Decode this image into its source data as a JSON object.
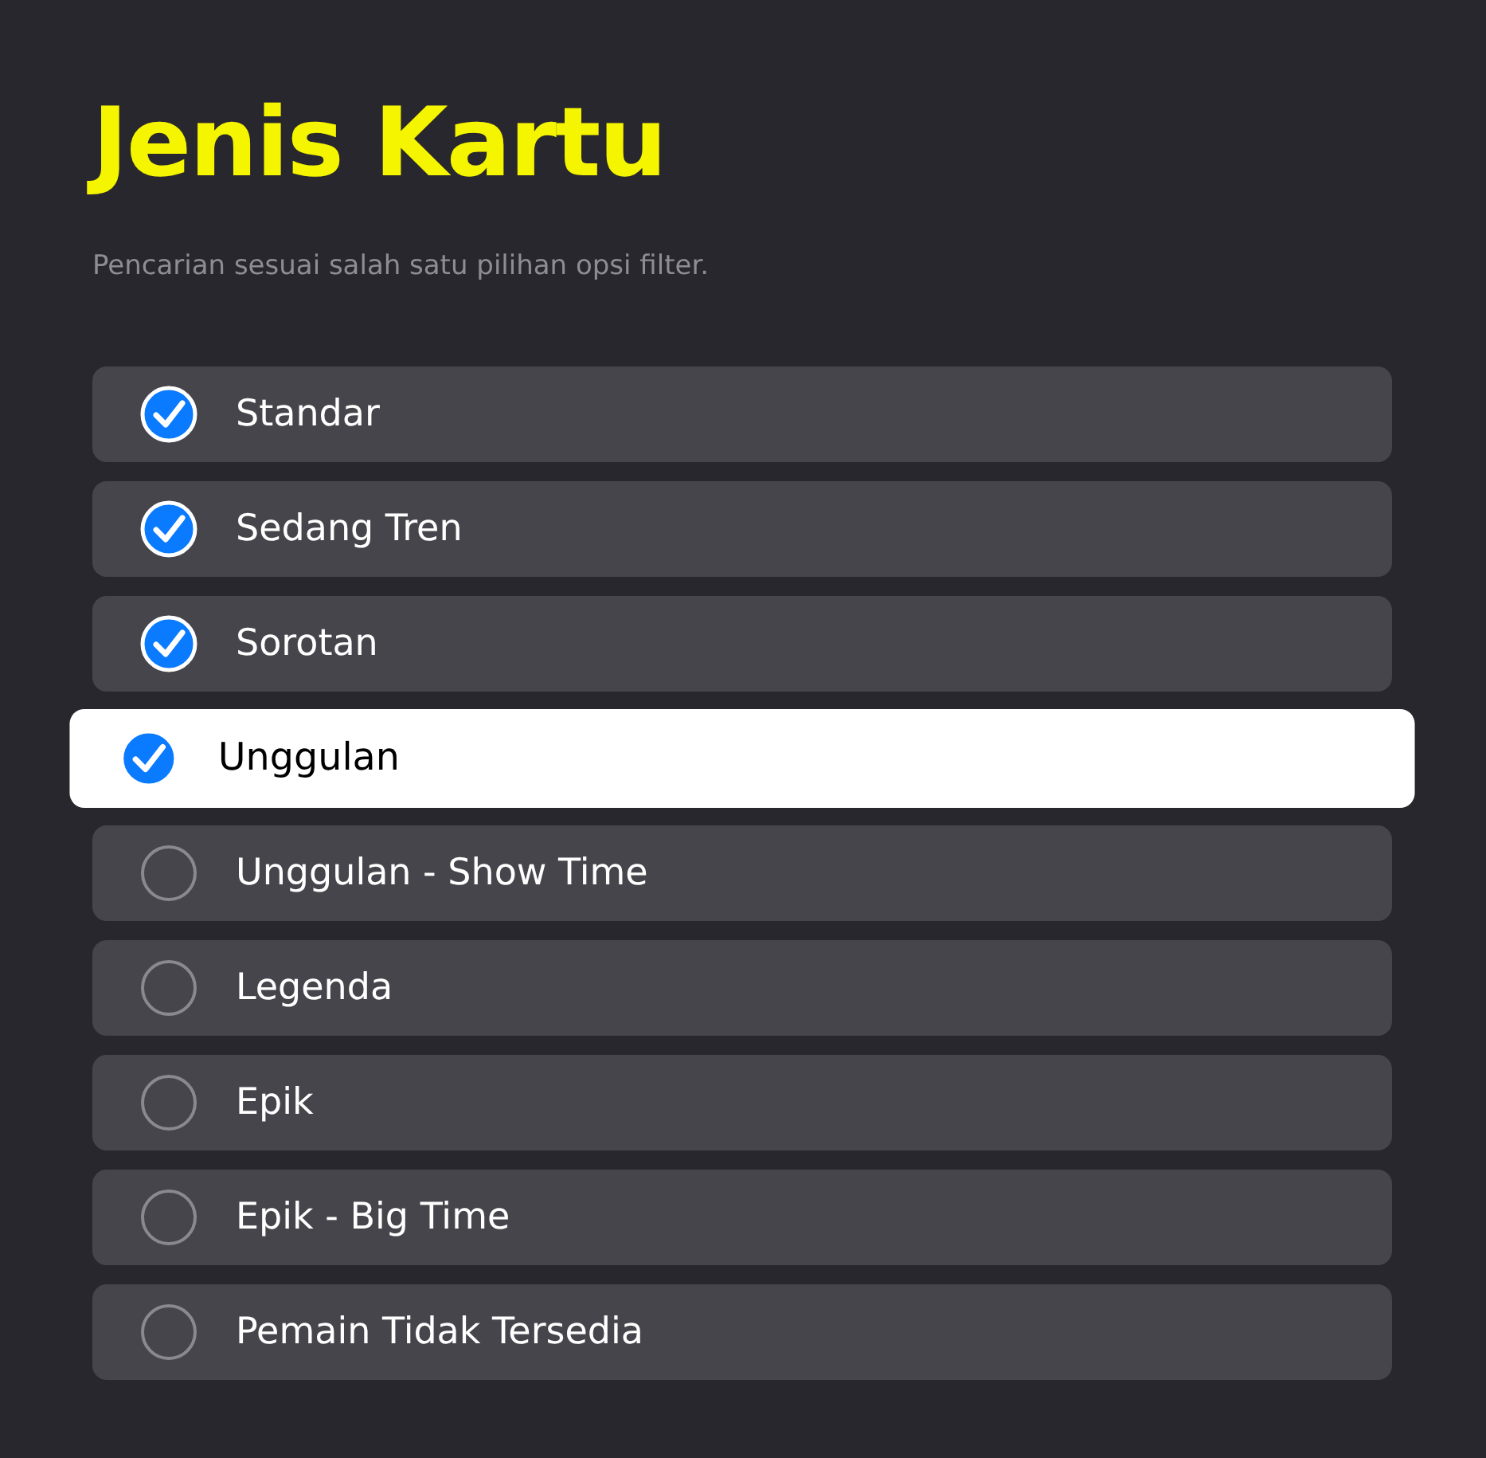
{
  "title": "Jenis Kartu",
  "subtitle": "Pencarian sesuai salah satu pilihan opsi filter.",
  "options": [
    {
      "label": "Standar",
      "checked": true,
      "focused": false
    },
    {
      "label": "Sedang Tren",
      "checked": true,
      "focused": false
    },
    {
      "label": "Sorotan",
      "checked": true,
      "focused": false
    },
    {
      "label": "Unggulan",
      "checked": true,
      "focused": true
    },
    {
      "label": "Unggulan - Show Time",
      "checked": false,
      "focused": false
    },
    {
      "label": "Legenda",
      "checked": false,
      "focused": false
    },
    {
      "label": "Epik",
      "checked": false,
      "focused": false
    },
    {
      "label": "Epik - Big Time",
      "checked": false,
      "focused": false
    },
    {
      "label": "Pemain Tidak Tersedia",
      "checked": false,
      "focused": false
    }
  ]
}
